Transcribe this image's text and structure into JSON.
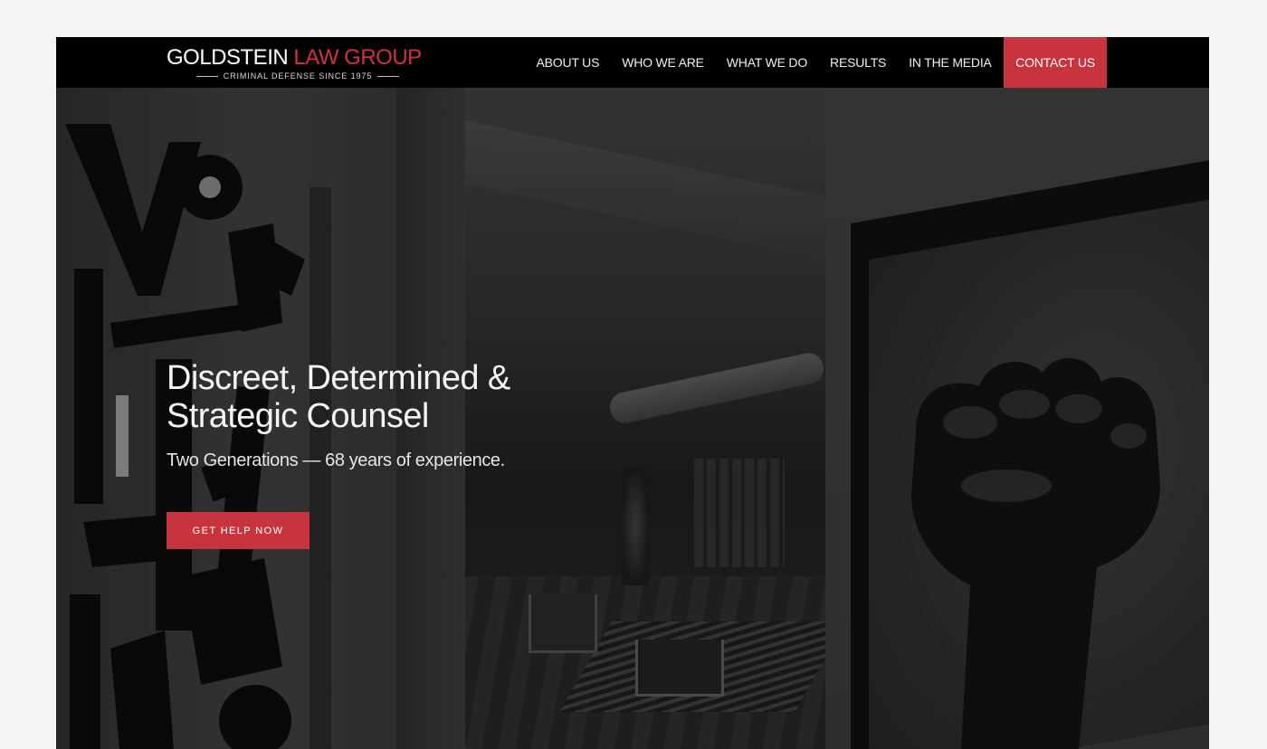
{
  "header": {
    "logo": {
      "name_part1": "GOLDSTEIN",
      "name_part2": "LAW GROUP",
      "tagline": "CRIMINAL DEFENSE SINCE 1975"
    },
    "nav": {
      "items": [
        {
          "label": "ABOUT US"
        },
        {
          "label": "WHO WE ARE"
        },
        {
          "label": "WHAT WE DO"
        },
        {
          "label": "RESULTS"
        },
        {
          "label": "IN THE MEDIA"
        },
        {
          "label": "CONTACT US"
        }
      ]
    }
  },
  "hero": {
    "headline_line1": "Discreet, Determined &",
    "headline_line2": "Strategic Counsel",
    "subheadline": "Two Generations — 68 years of experience.",
    "cta_label": "GET HELP NOW"
  },
  "colors": {
    "accent": "#c8343e",
    "header_bg": "#000000",
    "page_bg": "#f4f5f4"
  }
}
